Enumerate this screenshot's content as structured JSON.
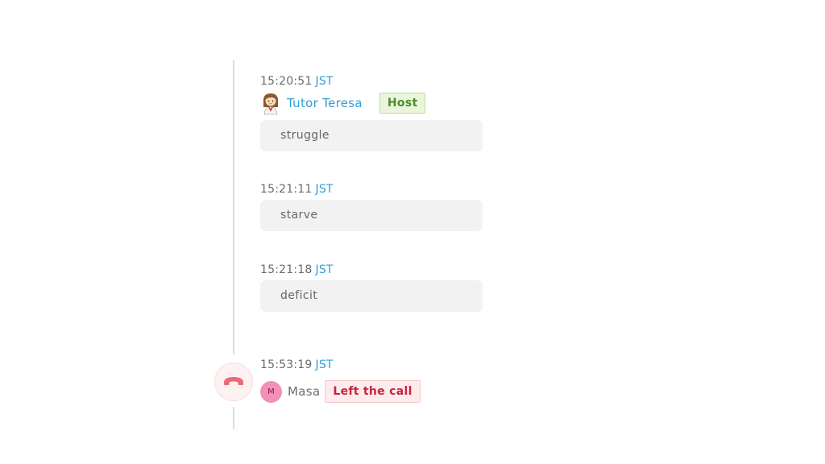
{
  "messages": [
    {
      "time": "15:20:51",
      "timezone": "JST",
      "user": {
        "name": "Tutor Teresa",
        "role_badge": "Host",
        "avatar_icon": "teresa-avatar-icon"
      },
      "text": "struggle"
    },
    {
      "time": "15:21:11",
      "timezone": "JST",
      "text": "starve"
    },
    {
      "time": "15:21:18",
      "timezone": "JST",
      "text": "deficit"
    }
  ],
  "event": {
    "time": "15:53:19",
    "timezone": "JST",
    "icon": "hang-up-phone-icon",
    "user": {
      "name": "Masa",
      "avatar_initial": "M"
    },
    "status_badge": "Left the call"
  },
  "colors": {
    "timezone": "#2f9fd6",
    "host_badge_bg": "#e9f6dc",
    "host_badge_text": "#4f8a2b",
    "left_badge_bg": "#fdebed",
    "left_badge_text": "#c8243c",
    "hangup_icon": "#ea6a75",
    "masa_avatar": "#f290b8"
  }
}
